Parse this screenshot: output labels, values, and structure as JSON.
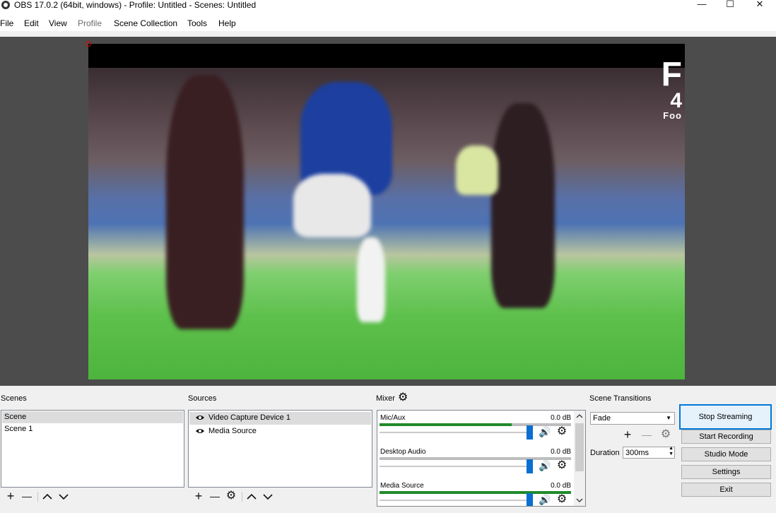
{
  "window": {
    "title": "OBS 17.0.2 (64bit, windows) - Profile: Untitled - Scenes: Untitled",
    "minimize": "—",
    "maximize": "☐",
    "close": "✕"
  },
  "menu": [
    "File",
    "Edit",
    "View",
    "Profile",
    "Scene Collection",
    "Tools",
    "Help"
  ],
  "preview": {
    "overlay_text_1": "F",
    "overlay_text_2": "4",
    "overlay_text_3": "Foo"
  },
  "scenes": {
    "title": "Scenes",
    "items": [
      "Scene",
      "Scene 1"
    ],
    "selected_index": 0
  },
  "sources": {
    "title": "Sources",
    "items": [
      "Video Capture Device 1",
      "Media Source"
    ],
    "selected_index": 0
  },
  "mixer": {
    "title": "Mixer",
    "channels": [
      {
        "name": "Mic/Aux",
        "db": "0.0 dB",
        "level": 0.69
      },
      {
        "name": "Desktop Audio",
        "db": "0.0 dB",
        "level": 0.0
      },
      {
        "name": "Media Source",
        "db": "0.0 dB",
        "level": 1.0
      }
    ]
  },
  "transitions": {
    "title": "Scene Transitions",
    "selected": "Fade",
    "duration_label": "Duration",
    "duration_value": "300ms"
  },
  "controls": {
    "stop_streaming": "Stop Streaming",
    "start_recording": "Start Recording",
    "studio_mode": "Studio Mode",
    "settings": "Settings",
    "exit": "Exit"
  },
  "icons": {
    "add": "+",
    "remove": "—",
    "up": "^",
    "down": "v"
  }
}
